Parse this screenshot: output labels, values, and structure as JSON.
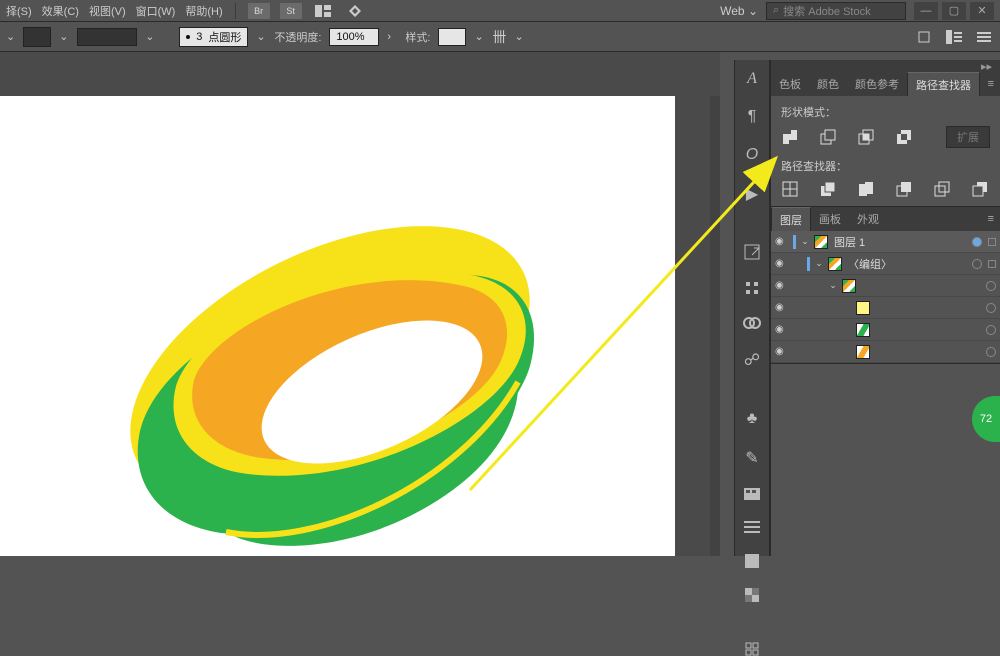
{
  "menu": {
    "select": "择(S)",
    "effect": "效果(C)",
    "view": "视图(V)",
    "window": "窗口(W)",
    "help": "帮助(H)"
  },
  "menubar_icons": {
    "br": "Br",
    "st": "St"
  },
  "workspace": {
    "label": "Web",
    "chev": "⌄"
  },
  "stock": {
    "placeholder": "搜索 Adobe Stock",
    "icon": "⌕"
  },
  "options": {
    "stroke_value": "3",
    "stroke_preset": "点圆形",
    "opacity_label": "不透明度",
    "opacity_value": "100%",
    "style_label": "样式"
  },
  "pathfinder_panel": {
    "tabs": [
      "色板",
      "颜色",
      "颜色参考",
      "路径查找器"
    ],
    "active_tab": 3,
    "shape_mode_label": "形状模式：",
    "pathfinder_label": "路径查找器：",
    "expand_label": "扩展"
  },
  "layers_panel": {
    "tabs": [
      "图层",
      "画板",
      "外观"
    ],
    "active_tab": 0,
    "rows": [
      {
        "name": "图层 1",
        "depth": 0,
        "expanded": true,
        "thumb": "thumb-stripe",
        "highlight": true,
        "selbox": true
      },
      {
        "name": "〈编组〉",
        "depth": 1,
        "expanded": true,
        "thumb": "thumb-stripe",
        "highlight": false,
        "selbox": true
      },
      {
        "name": "",
        "depth": 2,
        "expanded": true,
        "thumb": "thumb-stripe",
        "highlight": false,
        "selbox": false,
        "hasSelBar": false
      },
      {
        "name": "",
        "depth": 3,
        "thumb": "thumb-yellow",
        "hasSelBar": false
      },
      {
        "name": "",
        "depth": 3,
        "thumb": "thumb-green",
        "hasSelBar": false
      },
      {
        "name": "",
        "depth": 3,
        "thumb": "thumb-orange",
        "hasSelBar": false
      }
    ]
  },
  "badge": {
    "text": "72"
  },
  "chart_data": null
}
